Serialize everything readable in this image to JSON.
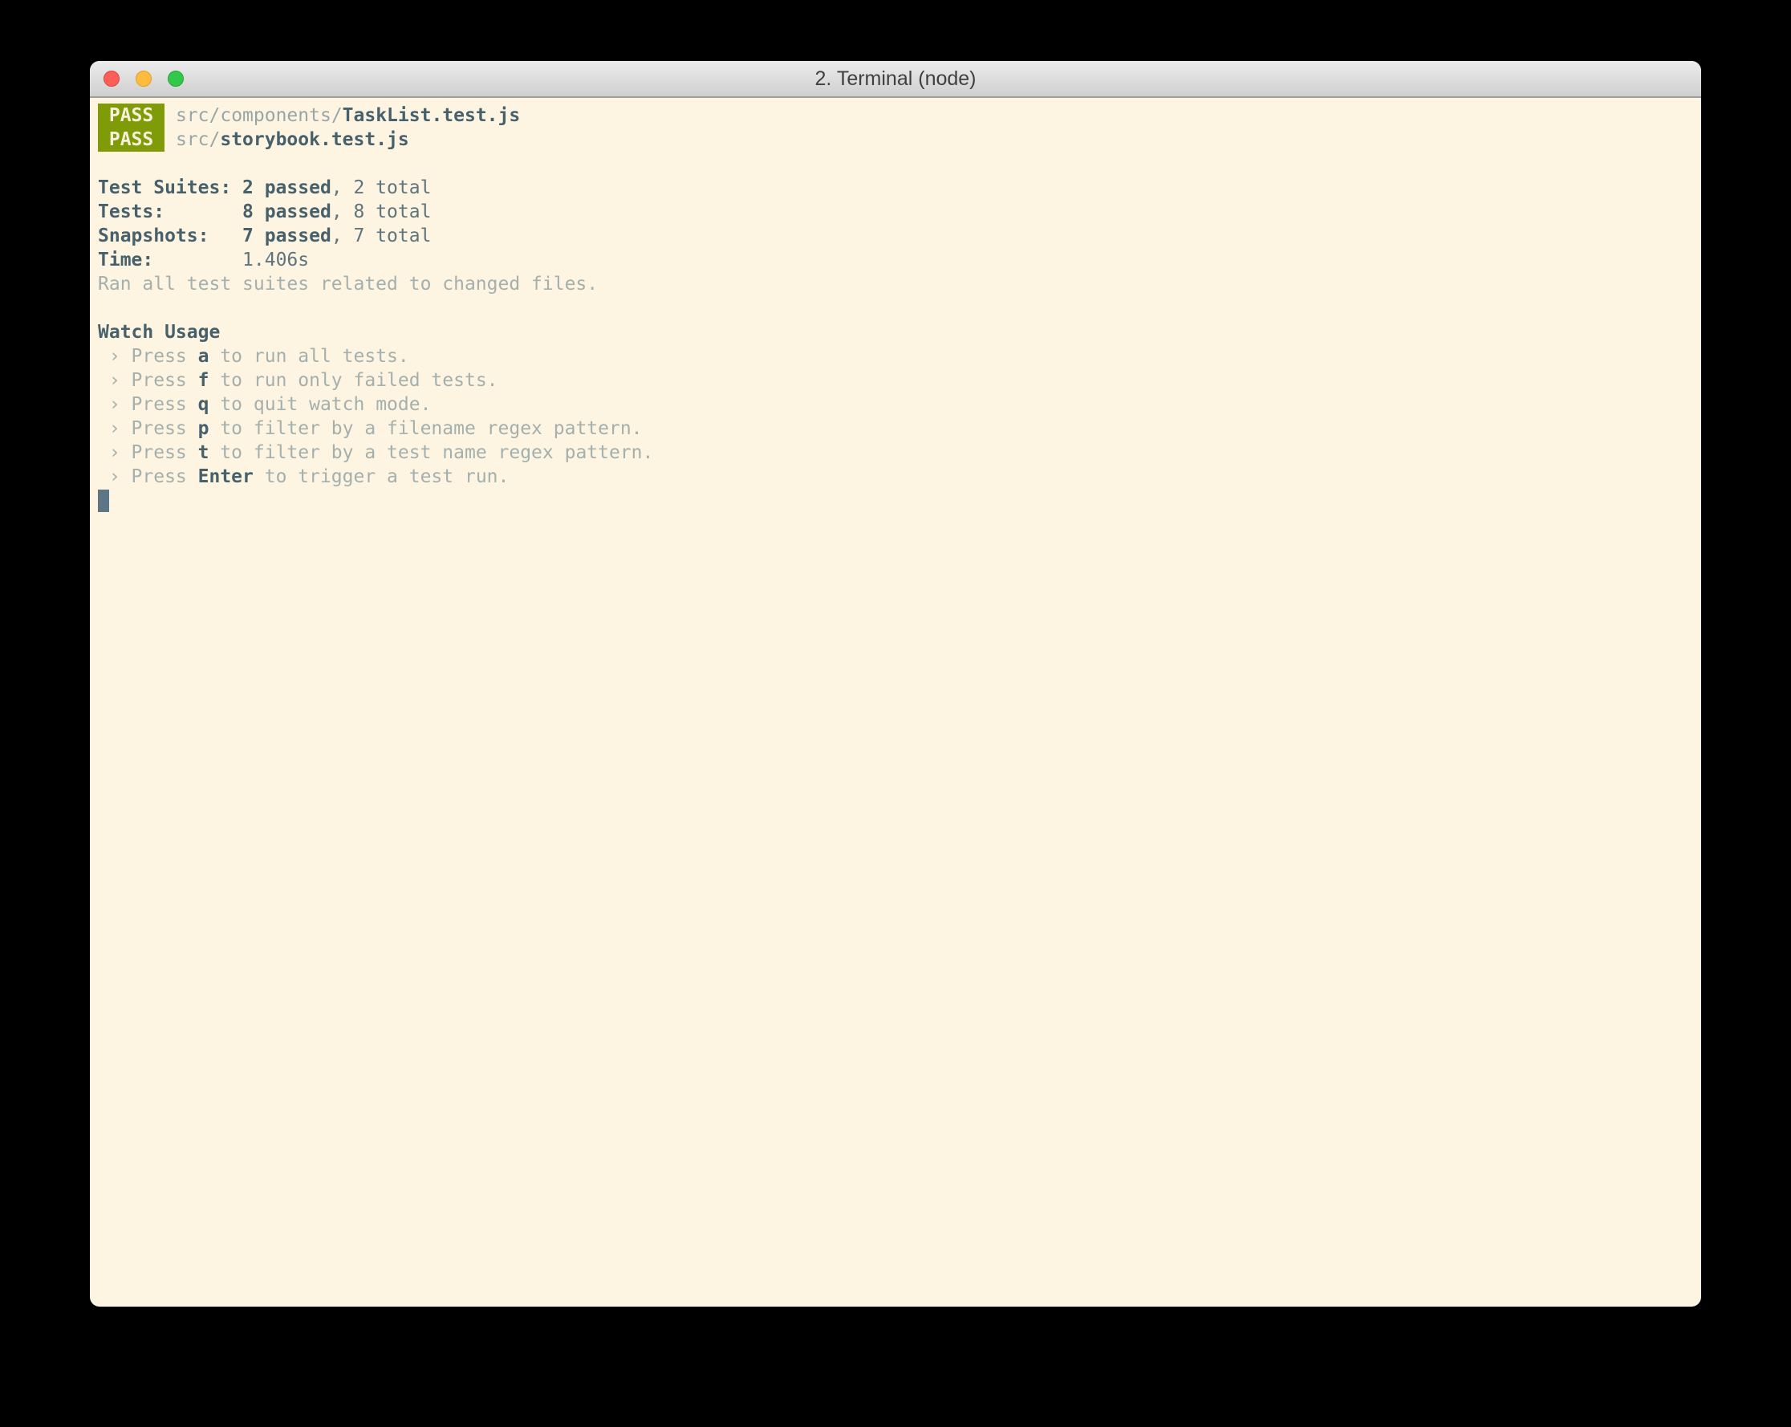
{
  "window": {
    "title": "2. Terminal (node)"
  },
  "colors": {
    "desktop_bg": "#000000",
    "terminal_bg": "#fdf4e1",
    "pass_badge_bg": "#7f9b08",
    "pass_badge_text": "#f7f0d9",
    "bold_text": "#47616c",
    "plain_text": "#5e757f",
    "muted_text": "#a3b0ad",
    "path_text": "#98a6a6",
    "cursor": "#5d7585",
    "traffic_red": "#fc5f57",
    "traffic_yellow": "#fdbc40",
    "traffic_green": "#34c84a"
  },
  "terminal": {
    "lines": [
      {
        "segments": [
          {
            "t": " PASS ",
            "s": "badge"
          },
          {
            "t": " ",
            "s": "path"
          },
          {
            "t": "src/components/",
            "s": "path"
          },
          {
            "t": "TaskList.test.js",
            "s": "file"
          }
        ]
      },
      {
        "segments": [
          {
            "t": " PASS ",
            "s": "badge"
          },
          {
            "t": " ",
            "s": "path"
          },
          {
            "t": "src/",
            "s": "path"
          },
          {
            "t": "storybook.test.js",
            "s": "file"
          }
        ]
      },
      {
        "segments": []
      },
      {
        "segments": [
          {
            "t": "Test Suites: ",
            "s": "label"
          },
          {
            "t": "2 passed",
            "s": "strong"
          },
          {
            "t": ", 2 total",
            "s": "plain"
          }
        ]
      },
      {
        "segments": [
          {
            "t": "Tests:",
            "s": "label"
          },
          {
            "t": "       ",
            "s": "plain"
          },
          {
            "t": "8 passed",
            "s": "strong"
          },
          {
            "t": ", 8 total",
            "s": "plain"
          }
        ]
      },
      {
        "segments": [
          {
            "t": "Snapshots:",
            "s": "label"
          },
          {
            "t": "   ",
            "s": "plain"
          },
          {
            "t": "7 passed",
            "s": "strong"
          },
          {
            "t": ", 7 total",
            "s": "plain"
          }
        ]
      },
      {
        "segments": [
          {
            "t": "Time:",
            "s": "label"
          },
          {
            "t": "        ",
            "s": "plain"
          },
          {
            "t": "1.406s",
            "s": "plain"
          }
        ]
      },
      {
        "segments": [
          {
            "t": "Ran all test suites related to changed files.",
            "s": "muted"
          }
        ]
      },
      {
        "segments": []
      },
      {
        "segments": [
          {
            "t": "Watch Usage",
            "s": "label"
          }
        ]
      },
      {
        "segments": [
          {
            "t": " › Press ",
            "s": "muted"
          },
          {
            "t": "a",
            "s": "key"
          },
          {
            "t": " to run all tests.",
            "s": "muted"
          }
        ]
      },
      {
        "segments": [
          {
            "t": " › Press ",
            "s": "muted"
          },
          {
            "t": "f",
            "s": "key"
          },
          {
            "t": " to run only failed tests.",
            "s": "muted"
          }
        ]
      },
      {
        "segments": [
          {
            "t": " › Press ",
            "s": "muted"
          },
          {
            "t": "q",
            "s": "key"
          },
          {
            "t": " to quit watch mode.",
            "s": "muted"
          }
        ]
      },
      {
        "segments": [
          {
            "t": " › Press ",
            "s": "muted"
          },
          {
            "t": "p",
            "s": "key"
          },
          {
            "t": " to filter by a filename regex pattern.",
            "s": "muted"
          }
        ]
      },
      {
        "segments": [
          {
            "t": " › Press ",
            "s": "muted"
          },
          {
            "t": "t",
            "s": "key"
          },
          {
            "t": " to filter by a test name regex pattern.",
            "s": "muted"
          }
        ]
      },
      {
        "segments": [
          {
            "t": " › Press ",
            "s": "muted"
          },
          {
            "t": "Enter",
            "s": "key"
          },
          {
            "t": " to trigger a test run.",
            "s": "muted"
          }
        ]
      },
      {
        "segments": [
          {
            "t": " ",
            "s": "cursor"
          }
        ]
      }
    ]
  }
}
